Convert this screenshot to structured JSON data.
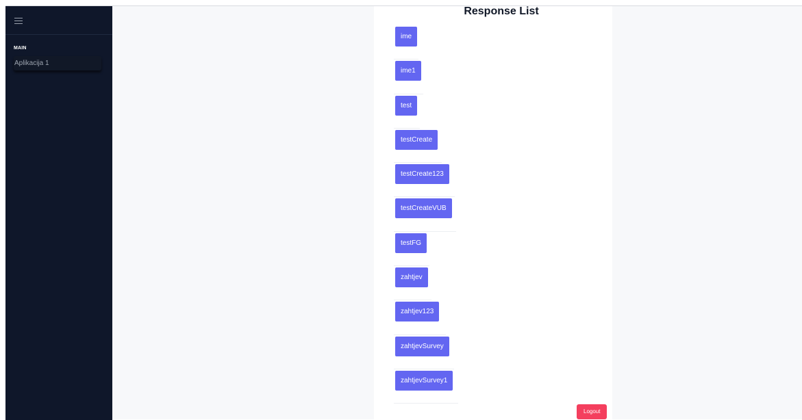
{
  "sidebar": {
    "menu_icon": "hamburger-menu-icon",
    "section_label": "MAIN",
    "items": [
      {
        "label": "Aplikacija 1"
      }
    ]
  },
  "main": {
    "title": "Response List",
    "responses": [
      {
        "label": "ime"
      },
      {
        "label": "ime1"
      },
      {
        "label": "test"
      },
      {
        "label": "testCreate"
      },
      {
        "label": "testCreate123"
      },
      {
        "label": "testCreateVUB"
      },
      {
        "label": "testFG"
      },
      {
        "label": "zahtjev"
      },
      {
        "label": "zahtjev123"
      },
      {
        "label": "zahtjevSurvey"
      },
      {
        "label": "zahtjevSurvey1"
      }
    ],
    "logout_label": "Logout"
  },
  "colors": {
    "sidebar_bg": "#0f172a",
    "page_bg": "#f7f8fa",
    "button_accent": "#6366f1",
    "logout_accent": "#f43f5e"
  }
}
